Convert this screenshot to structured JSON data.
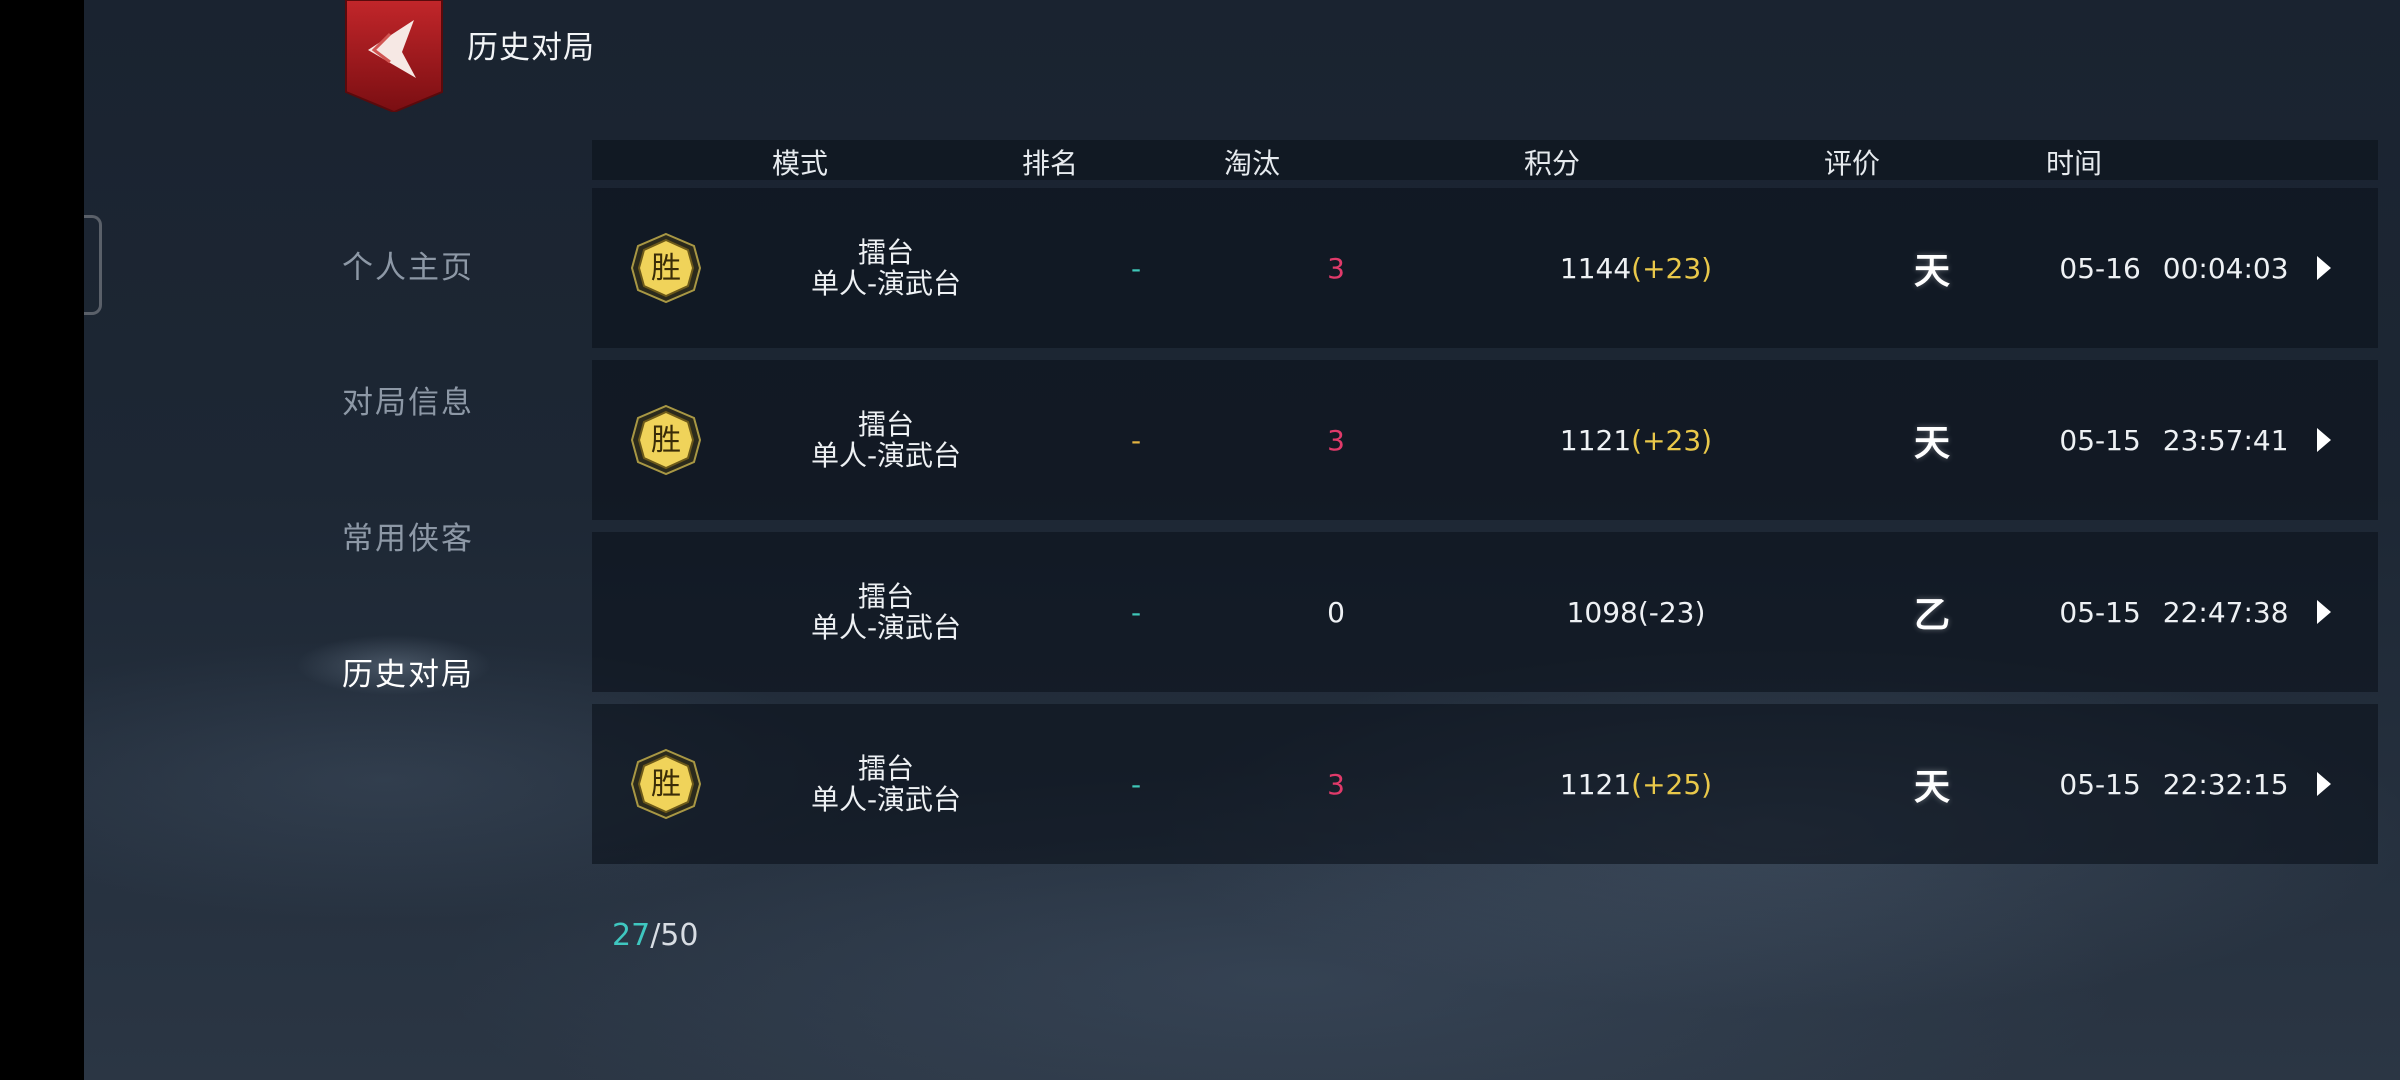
{
  "header": {
    "title": "历史对局"
  },
  "sidebar": {
    "items": [
      {
        "label": "个人主页",
        "active": false
      },
      {
        "label": "对局信息",
        "active": false
      },
      {
        "label": "常用侠客",
        "active": false
      },
      {
        "label": "历史对局",
        "active": true
      }
    ]
  },
  "table": {
    "columns": [
      "模式",
      "排名",
      "淘汰",
      "积分",
      "评价",
      "时间"
    ],
    "rows": [
      {
        "badge": "胜",
        "mode_line1": "擂台",
        "mode_line2": "单人-演武台",
        "rank": "-",
        "rank_color": "#3fc7b8",
        "eliminations": "3",
        "elim_color": "#e03a6a",
        "score": "1144",
        "score_delta": "(+23)",
        "delta_color": "#e9c84a",
        "grade": "天",
        "date": "05-16",
        "time": "00:04:03"
      },
      {
        "badge": "胜",
        "mode_line1": "擂台",
        "mode_line2": "单人-演武台",
        "rank": "-",
        "rank_color": "#e3b341",
        "eliminations": "3",
        "elim_color": "#e03a6a",
        "score": "1121",
        "score_delta": "(+23)",
        "delta_color": "#e9c84a",
        "grade": "天",
        "date": "05-15",
        "time": "23:57:41"
      },
      {
        "badge": "",
        "mode_line1": "擂台",
        "mode_line2": "单人-演武台",
        "rank": "-",
        "rank_color": "#3fc7b8",
        "eliminations": "0",
        "elim_color": "#eef1f4",
        "score": "1098",
        "score_delta": "(-23)",
        "delta_color": "#eef1f4",
        "grade": "乙",
        "date": "05-15",
        "time": "22:47:38"
      },
      {
        "badge": "胜",
        "mode_line1": "擂台",
        "mode_line2": "单人-演武台",
        "rank": "-",
        "rank_color": "#3fc7b8",
        "eliminations": "3",
        "elim_color": "#e03a6a",
        "score": "1121",
        "score_delta": "(+25)",
        "delta_color": "#e9c84a",
        "grade": "天",
        "date": "05-15",
        "time": "22:32:15"
      }
    ]
  },
  "pager": {
    "current": "27",
    "separator": "/",
    "total": "50"
  },
  "colors": {
    "accent_teal": "#3fc7c0",
    "win_gold": "#f0d35a",
    "back_red": "#a8161b"
  },
  "icons": {
    "back": "back-arrow-icon",
    "detail": "play-arrow-icon",
    "badge": "win-badge-icon"
  }
}
